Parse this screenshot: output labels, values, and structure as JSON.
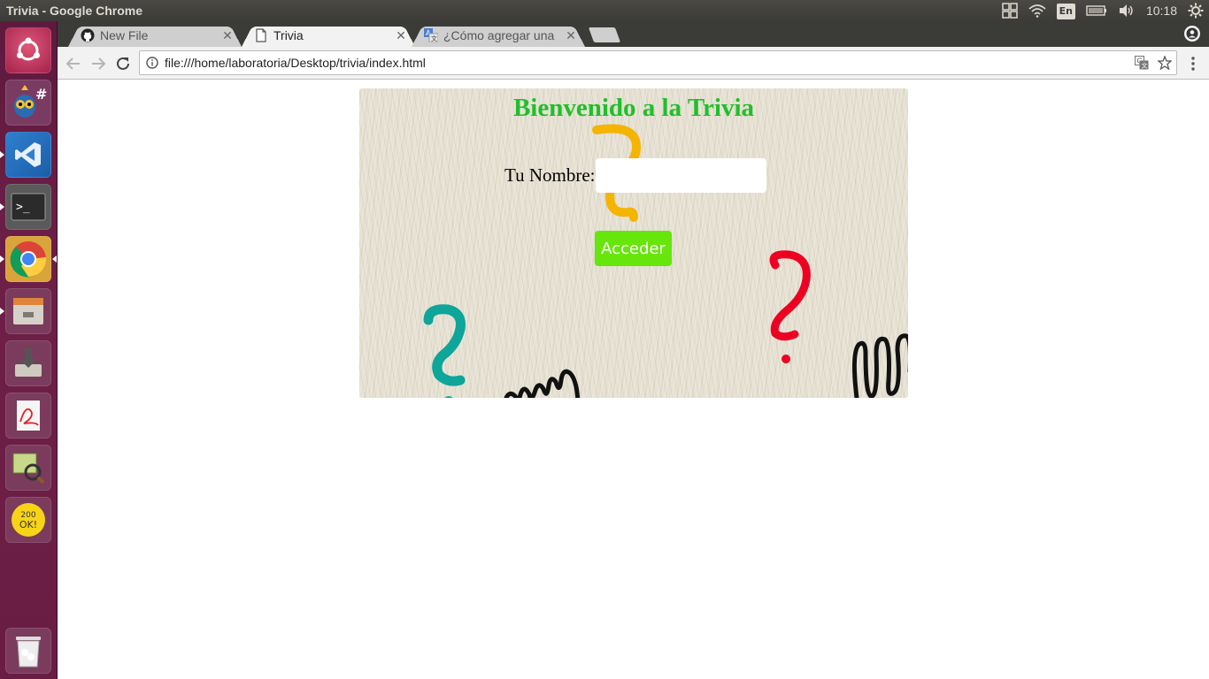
{
  "system": {
    "window_title": "Trivia - Google Chrome",
    "keyboard_layout": "En",
    "clock": "10:18",
    "icons": [
      "windows-layout-icon",
      "wifi-icon",
      "keyboard-icon",
      "battery-icon",
      "volume-icon",
      "settings-gear-icon"
    ]
  },
  "launcher": {
    "items": [
      {
        "name": "ubuntu-dash-icon"
      },
      {
        "name": "monodevelop-icon"
      },
      {
        "name": "vscode-icon"
      },
      {
        "name": "terminal-icon"
      },
      {
        "name": "chrome-icon"
      },
      {
        "name": "files-icon"
      },
      {
        "name": "installer-icon"
      },
      {
        "name": "document-viewer-icon"
      },
      {
        "name": "image-viewer-icon"
      },
      {
        "name": "app-200ok-icon",
        "label": "200 OK!"
      },
      {
        "name": "trash-icon"
      }
    ]
  },
  "browser": {
    "tabs": [
      {
        "title": "New File",
        "icon": "github-icon",
        "active": false
      },
      {
        "title": "Trivia",
        "icon": "page-icon",
        "active": true
      },
      {
        "title": "¿Cómo agregar una",
        "icon": "translate-icon",
        "active": false
      }
    ],
    "address": "file:///home/laboratoria/Desktop/trivia/index.html"
  },
  "page": {
    "title": "Bienvenido a la Trivia",
    "name_label": "Tu Nombre:",
    "name_value": "",
    "button_label": "Acceder",
    "colors": {
      "title": "#1fbf2a",
      "button": "#66e60a",
      "card_bg": "#e6e1d3",
      "qmark_yellow": "#f4b400",
      "qmark_red": "#ee0022",
      "qmark_teal": "#0ea59a"
    }
  }
}
